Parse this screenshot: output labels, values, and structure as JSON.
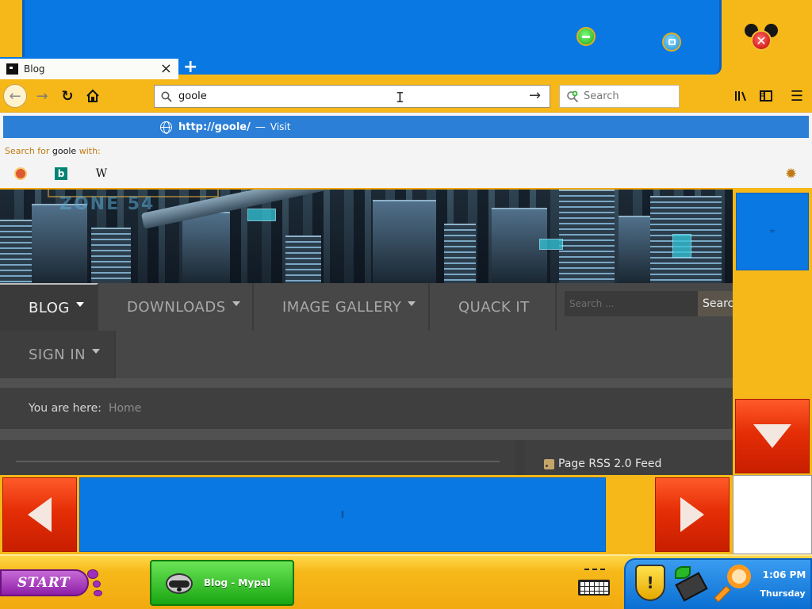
{
  "browser": {
    "tab": {
      "title": "Blog",
      "close_glyph": "×"
    },
    "new_tab_glyph": "+",
    "url_bar": {
      "value": "goole"
    },
    "search_bar": {
      "placeholder": "Search"
    },
    "dropdown": {
      "suggestion_url": "http://goole/",
      "suggestion_separator": "—",
      "suggestion_action": "Visit",
      "search_with_prefix": "Search for",
      "search_with_query": "goole",
      "search_with_suffix": "with:",
      "engines": [
        {
          "icon": "duckduckgo-icon"
        },
        {
          "icon": "bing-icon",
          "glyph": "b"
        },
        {
          "icon": "wikipedia-icon",
          "glyph": "W"
        }
      ]
    }
  },
  "site": {
    "nav": {
      "blog": "BLOG",
      "downloads": "DOWNLOADS",
      "gallery": "IMAGE GALLERY",
      "quack": "QUACK IT",
      "signin": "SIGN IN"
    },
    "search": {
      "placeholder": "Search ...",
      "button": "Search"
    },
    "breadcrumb": {
      "label": "You are here:",
      "home": "Home"
    },
    "rss": {
      "label": "Page RSS 2.0 Feed"
    }
  },
  "taskbar": {
    "start_label": "START",
    "task_item": "Blog - Mypal",
    "clock_time": "1:06 PM",
    "clock_day": "Thursday"
  },
  "colors": {
    "theme_yellow": "#f6b819",
    "theme_blue": "#0a78e2",
    "scroll_red": "#e52e06",
    "suggest_blue": "#2b7fd6"
  }
}
